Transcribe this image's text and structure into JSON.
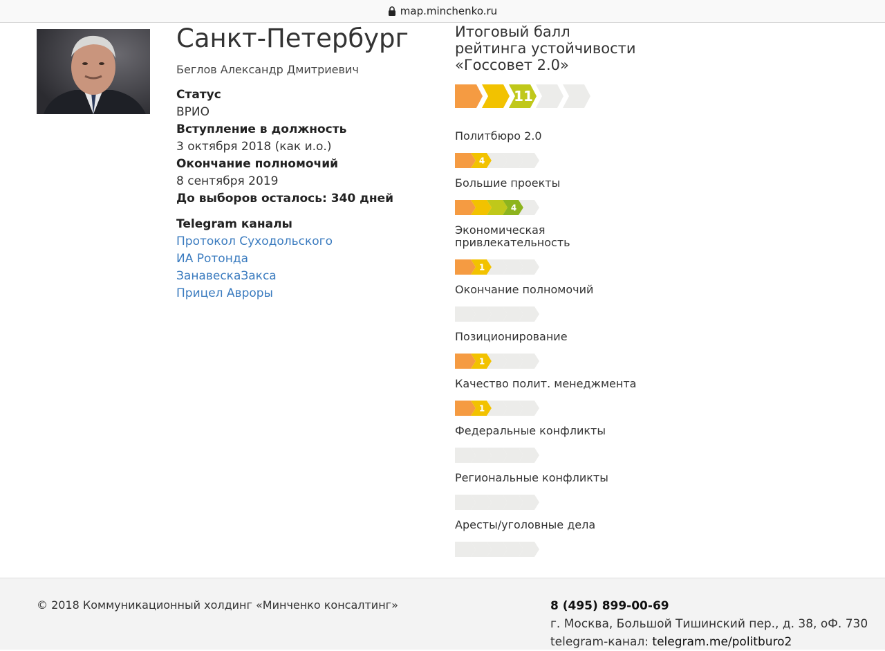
{
  "browser": {
    "url": "map.minchenko.ru"
  },
  "profile": {
    "city": "Санкт-Петербург",
    "person": "Беглов Александр Дмитриевич",
    "status_label": "Статус",
    "status_value": "ВРИО",
    "start_label": "Вступление в должность",
    "start_value": "3 октября 2018 (как и.о.)",
    "end_label": "Окончание полномочий",
    "end_value": "8 сентября 2019",
    "election_countdown": "До выборов осталось: 340 дней"
  },
  "telegram": {
    "heading": "Telegram каналы",
    "links": [
      "Протокол Суходольского",
      "ИА Ротонда",
      "ЗанавескаЗакса",
      "Прицел Авроры"
    ]
  },
  "rating": {
    "title_line1": "Итоговый балл",
    "title_line2": "рейтинга устойчивости",
    "title_line3": "«Госсовет 2.0»",
    "total_score": "11",
    "total_filled_segments": 3,
    "criteria": [
      {
        "label": "Политбюро 2.0",
        "score": "4",
        "filled": 2
      },
      {
        "label": "Большие проекты",
        "score": "4",
        "filled": 4
      },
      {
        "label": "Экономическая привлекательность",
        "score": "1",
        "filled": 2
      },
      {
        "label": "Окончание полномочий",
        "score": "",
        "filled": 0
      },
      {
        "label": "Позиционирование",
        "score": "1",
        "filled": 2
      },
      {
        "label": "Качество полит. менеджмента",
        "score": "1",
        "filled": 2
      },
      {
        "label": "Федеральные конфликты",
        "score": "",
        "filled": 0
      },
      {
        "label": "Региональные конфликты",
        "score": "",
        "filled": 0
      },
      {
        "label": "Аресты/уголовные дела",
        "score": "",
        "filled": 0
      }
    ]
  },
  "colors": {
    "segment_1": "#f59b42",
    "segment_2": "#f2c200",
    "segment_3": "#c0c81a",
    "segment_4": "#8db41e",
    "segment_5": "#5fa52a",
    "empty": "#ececea",
    "link": "#3a7bbf"
  },
  "footer": {
    "copyright": "© 2018 Коммуникационный холдинг «Минченко консалтинг»",
    "phone": "8 (495) 899-00-69",
    "address": "г. Москва, Большой Тишинский пер., д. 38, оФ. 730",
    "telegram_label": "telegram-канал:",
    "telegram_url": "telegram.me/politburo2"
  }
}
